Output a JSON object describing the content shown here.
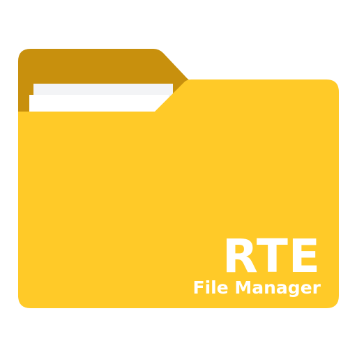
{
  "logo": {
    "title": "RTE",
    "subtitle": "File Manager",
    "icon": "folder-icon",
    "colors": {
      "folder_front": "#FFCA28",
      "folder_back": "#C8900D",
      "paper_back": "#F3F4F6",
      "paper_front": "#FFFFFF",
      "text": "#FFFFFF"
    }
  }
}
